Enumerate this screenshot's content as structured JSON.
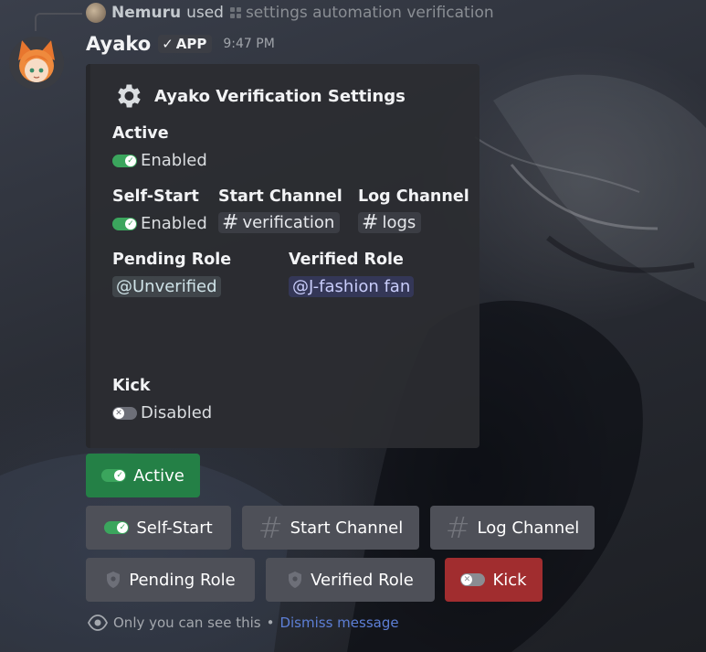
{
  "reply": {
    "username": "Nemuru",
    "action": "used",
    "command": "settings automation verification"
  },
  "message": {
    "username": "Ayako",
    "badge": "APP",
    "timestamp": "9:47 PM"
  },
  "embed": {
    "title": "Ayako Verification Settings",
    "fields": {
      "active": {
        "label": "Active",
        "value": "Enabled"
      },
      "self_start": {
        "label": "Self-Start",
        "value": "Enabled"
      },
      "start_channel": {
        "label": "Start Channel",
        "value": "verification"
      },
      "log_channel": {
        "label": "Log Channel",
        "value": "logs"
      },
      "pending_role": {
        "label": "Pending Role",
        "value": "@Unverified"
      },
      "verified_role": {
        "label": "Verified Role",
        "value": "@J-fashion fan"
      },
      "kick": {
        "label": "Kick",
        "value": "Disabled"
      }
    }
  },
  "buttons": {
    "active": "Active",
    "self_start": "Self-Start",
    "start_channel": "Start Channel",
    "log_channel": "Log Channel",
    "pending_role": "Pending Role",
    "verified_role": "Verified Role",
    "kick": "Kick"
  },
  "footer": {
    "notice": "Only you can see this",
    "separator": "•",
    "dismiss": "Dismiss message"
  },
  "colors": {
    "success": "#248046",
    "secondary": "#4e5058",
    "danger": "#a12d2f",
    "toggle_on": "#3ba55d"
  }
}
